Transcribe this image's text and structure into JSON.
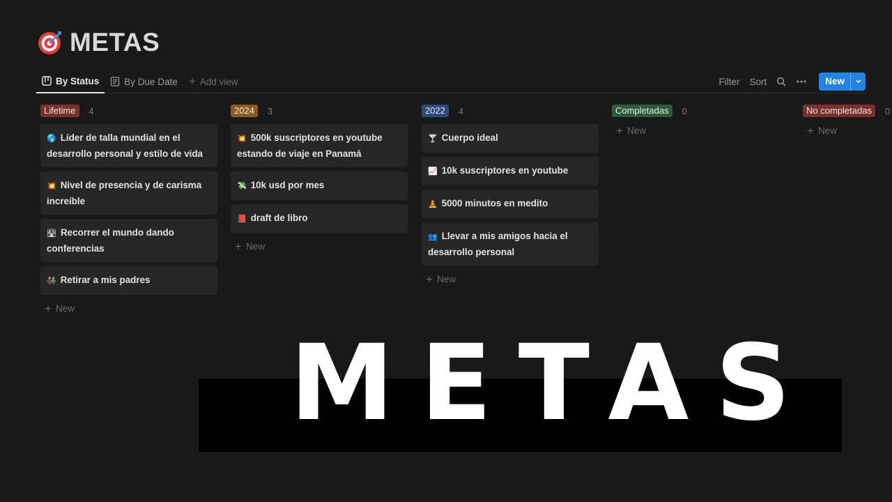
{
  "page": {
    "title": "METAS",
    "icon": "target-icon"
  },
  "views": {
    "tabs": [
      {
        "label": "By Status",
        "icon": "board-icon",
        "active": true
      },
      {
        "label": "By Due Date",
        "icon": "document-icon",
        "active": false
      }
    ],
    "add_view_label": "Add view"
  },
  "toolbar": {
    "filter_label": "Filter",
    "sort_label": "Sort",
    "search_icon": "search-icon",
    "more_icon": "ellipsis-icon",
    "new_label": "New",
    "accent": "#2383e2"
  },
  "board": {
    "new_label": "New",
    "columns": [
      {
        "label": "Lifetime",
        "count": "4",
        "color": "#7b2f2b",
        "cards": [
          {
            "emoji": "🌎",
            "text": "Líder de talla mundial en el desarrollo personal y estilo de vida"
          },
          {
            "emoji": "💥",
            "text": "Nivel de presencia y de carisma increíble"
          },
          {
            "emoji": "🛣",
            "text": "Recorrer el mundo dando conferencias"
          },
          {
            "emoji": "👫",
            "text": "Retirar a mis padres"
          }
        ]
      },
      {
        "label": "2024",
        "count": "3",
        "color": "#8c5a1e",
        "cards": [
          {
            "emoji": "💥",
            "text": "500k suscriptores en youtube estando de viaje en Panamá"
          },
          {
            "emoji": "💸",
            "text": "10k usd por mes"
          },
          {
            "emoji": "📕",
            "text": "draft de libro"
          }
        ]
      },
      {
        "label": "2022",
        "count": "4",
        "color": "#2c4a78",
        "cards": [
          {
            "emoji": "🍸",
            "text": "Cuerpo ideal"
          },
          {
            "emoji": "📈",
            "text": "10k suscriptores en youtube"
          },
          {
            "emoji": "🧘",
            "text": "5000 minutos en medito"
          },
          {
            "emoji": "👥",
            "text": "Llevar a mis amigos hacia el desarrollo personal"
          }
        ]
      },
      {
        "label": "Completadas",
        "count": "0",
        "color": "#2d5a3b",
        "cards": []
      },
      {
        "label": "No completadas",
        "count": "0",
        "color": "#7b2f2b",
        "cards": []
      }
    ]
  },
  "overlay": {
    "big_text": "METAS"
  }
}
